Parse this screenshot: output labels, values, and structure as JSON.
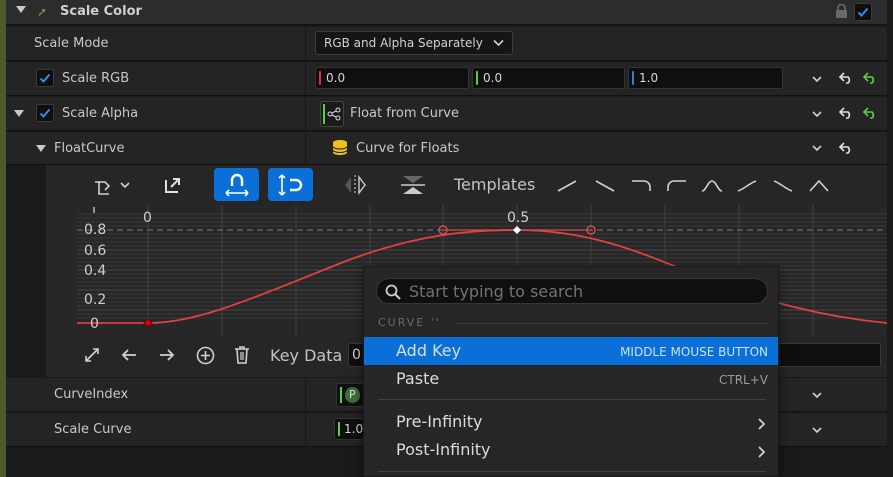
{
  "section": {
    "title": "Scale Color"
  },
  "scale_mode": {
    "label": "Scale Mode",
    "value": "RGB and Alpha Separately"
  },
  "scale_rgb": {
    "label": "Scale RGB",
    "r": "0.0",
    "g": "0.0",
    "b": "1.0"
  },
  "scale_alpha": {
    "label": "Scale Alpha",
    "value": "Float from Curve"
  },
  "float_curve": {
    "label": "FloatCurve",
    "value": "Curve for Floats"
  },
  "templates_label": "Templates",
  "curve_editor": {
    "time_labels": [
      "0",
      "0.5"
    ],
    "value_labels": [
      "0.8",
      "0.6",
      "0.4",
      "0.2",
      "0"
    ],
    "key_data_label": "Key Data",
    "key_data_value": "0"
  },
  "curve_index": {
    "label": "CurveIndex",
    "value_partial": "P"
  },
  "scale_curve": {
    "label": "Scale Curve",
    "value_partial": "1.0"
  },
  "context_menu": {
    "search_placeholder": "Start typing to search",
    "section_title": "CURVE ''",
    "items": [
      {
        "label": "Add Key",
        "shortcut": "MIDDLE MOUSE BUTTON"
      },
      {
        "label": "Paste",
        "shortcut": "CTRL+V"
      },
      {
        "label": "Pre-Infinity"
      },
      {
        "label": "Post-Infinity"
      }
    ]
  },
  "colors": {
    "accent": "#0a70d8",
    "curve": "#e04040",
    "r": "#e03030",
    "g": "#5ad040",
    "b": "#3a7ae0"
  }
}
